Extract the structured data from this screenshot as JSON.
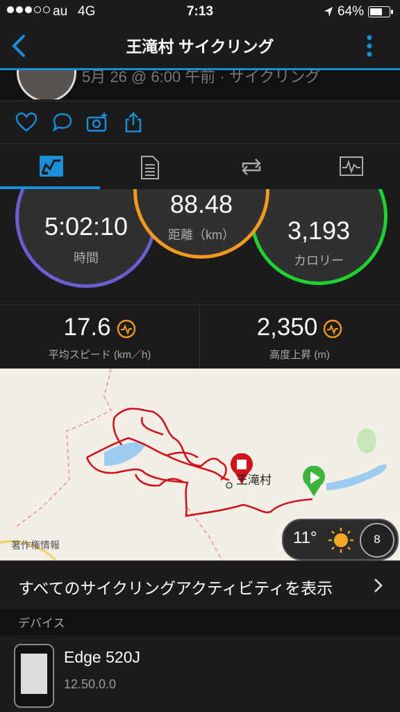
{
  "status_bar": {
    "carrier": "au",
    "network": "4G",
    "time": "7:13",
    "battery": "64%",
    "battery_level": 0.64
  },
  "nav": {
    "title": "王滝村 サイクリング"
  },
  "header": {
    "subtitle": "5月 26 @ 6:00 午前 · サイクリング"
  },
  "stats": {
    "time": {
      "value": "5:02:10",
      "label": "時間"
    },
    "distance": {
      "value": "88.48",
      "label": "距離（km）"
    },
    "calories": {
      "value": "3,193",
      "label": "カロリー"
    },
    "avg_speed": {
      "value": "17.6",
      "label": "平均スピード (km／h)"
    },
    "ascent": {
      "value": "2,350",
      "label": "高度上昇 (m)"
    }
  },
  "map": {
    "place": "王滝村",
    "copyright": "著作権情報",
    "temperature": "11°",
    "wind": "8"
  },
  "all_activities": {
    "label": "すべてのサイクリングアクティビティを表示"
  },
  "device": {
    "section_label": "デバイス",
    "name": "Edge 520J",
    "version": "12.50.0.0"
  },
  "colors": {
    "accent": "#1a8fd6",
    "time_ring": "#6a5fd0",
    "distance_ring": "#f39a1e",
    "calories_ring": "#1fd12f",
    "route": "#d0121b"
  },
  "icons": [
    "back-icon",
    "menu-icon",
    "heart-icon",
    "comment-icon",
    "add-photo-icon",
    "share-icon",
    "stats-tab-icon",
    "details-tab-icon",
    "laps-tab-icon",
    "chart-tab-icon",
    "sun-icon",
    "chevron-right-icon"
  ]
}
